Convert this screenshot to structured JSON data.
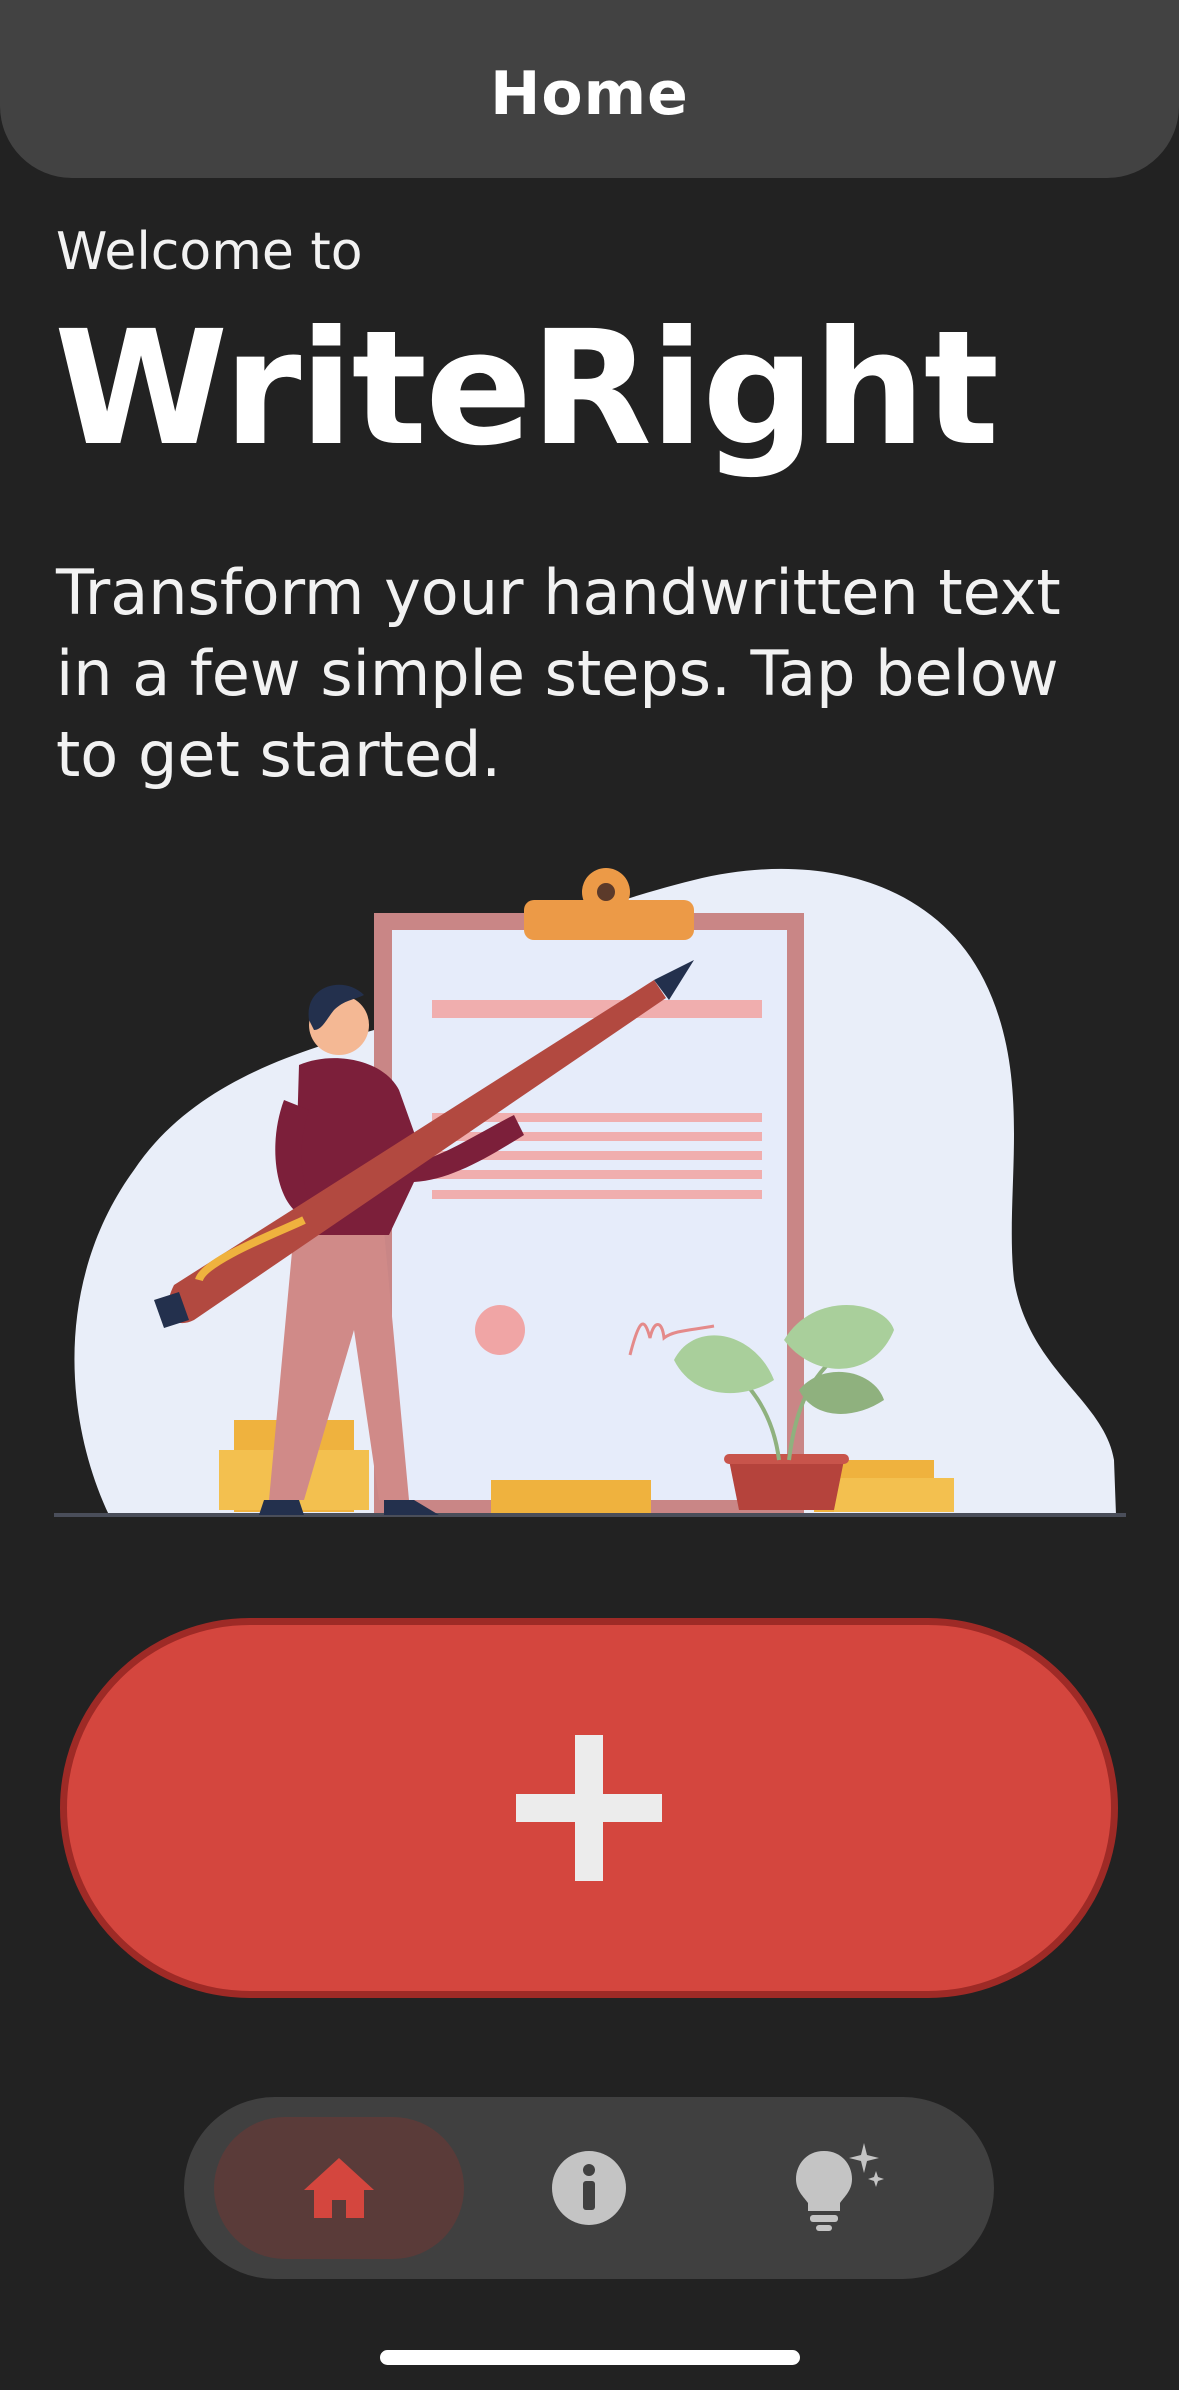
{
  "header": {
    "title": "Home"
  },
  "hero": {
    "welcome": "Welcome to",
    "brand": "WriteRight",
    "description": "Transform your handwritten text in a few simple steps. Tap below to get started."
  },
  "illustration": {
    "icon": "person-with-pen-and-clipboard-illustration"
  },
  "add_button": {
    "icon": "plus-icon",
    "color": "#d4463e"
  },
  "tabbar": {
    "tabs": [
      {
        "name": "home",
        "icon": "home-icon",
        "active": true,
        "color": "#d4463e"
      },
      {
        "name": "info",
        "icon": "info-icon",
        "active": false
      },
      {
        "name": "tips",
        "icon": "lightbulb-sparkle-icon",
        "active": false
      }
    ]
  },
  "colors": {
    "background": "#222222",
    "header": "#424242",
    "accent": "#d4463e"
  }
}
